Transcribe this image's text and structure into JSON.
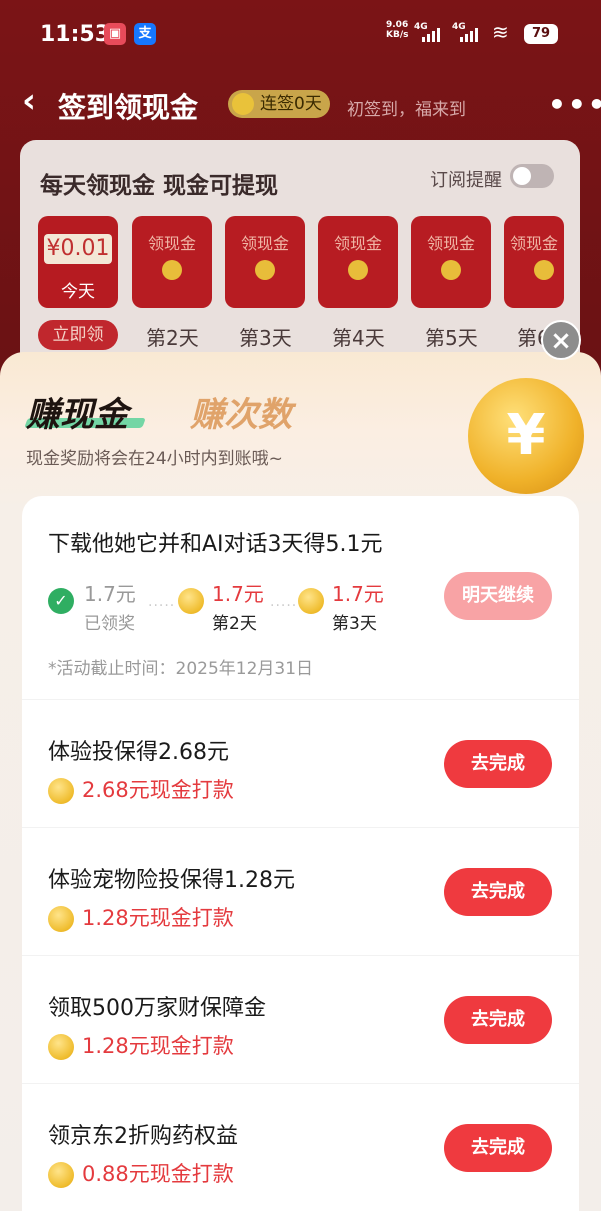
{
  "status_bar": {
    "time": "11:53",
    "net_speed": "9.06",
    "net_unit": "KB/s",
    "sig1": "4G",
    "sig2": "4G",
    "battery": "79"
  },
  "nav": {
    "back": "‹",
    "title": "签到领现金",
    "streak": "连签0天",
    "subtitle": "初签到，福来到",
    "more": "•••"
  },
  "checkin_card": {
    "title": "每天领现金 现金可提现",
    "subscribe": "订阅提醒",
    "first_amount": "¥0.01",
    "today": "今天",
    "envelope_label": "领现金",
    "now_button": "立即领",
    "days": [
      "第2天",
      "第3天",
      "第4天",
      "第5天",
      "第6"
    ]
  },
  "sheet": {
    "tab_active": "赚现金",
    "tab_inactive": "赚次数",
    "hint": "现金奖励将会在24小时内到账哦~",
    "close": "×",
    "coin_symbol": "¥"
  },
  "tasks": [
    {
      "title": "下载他她它并和AI对话3天得5.1元",
      "steps": [
        {
          "amount": "1.7元",
          "label": "已领奖"
        },
        {
          "amount": "1.7元",
          "label": "第2天"
        },
        {
          "amount": "1.7元",
          "label": "第3天"
        }
      ],
      "deadline": "*活动截止时间：2025年12月31日",
      "button": "明天继续"
    },
    {
      "title": "体验投保得2.68元",
      "reward": "2.68元现金打款",
      "button": "去完成"
    },
    {
      "title": "体验宠物险投保得1.28元",
      "reward": "1.28元现金打款",
      "button": "去完成"
    },
    {
      "title": "领取500万家财保障金",
      "reward": "1.28元现金打款",
      "button": "去完成"
    },
    {
      "title": "领京东2折购药权益",
      "reward": "0.88元现金打款",
      "button": "去完成"
    }
  ]
}
